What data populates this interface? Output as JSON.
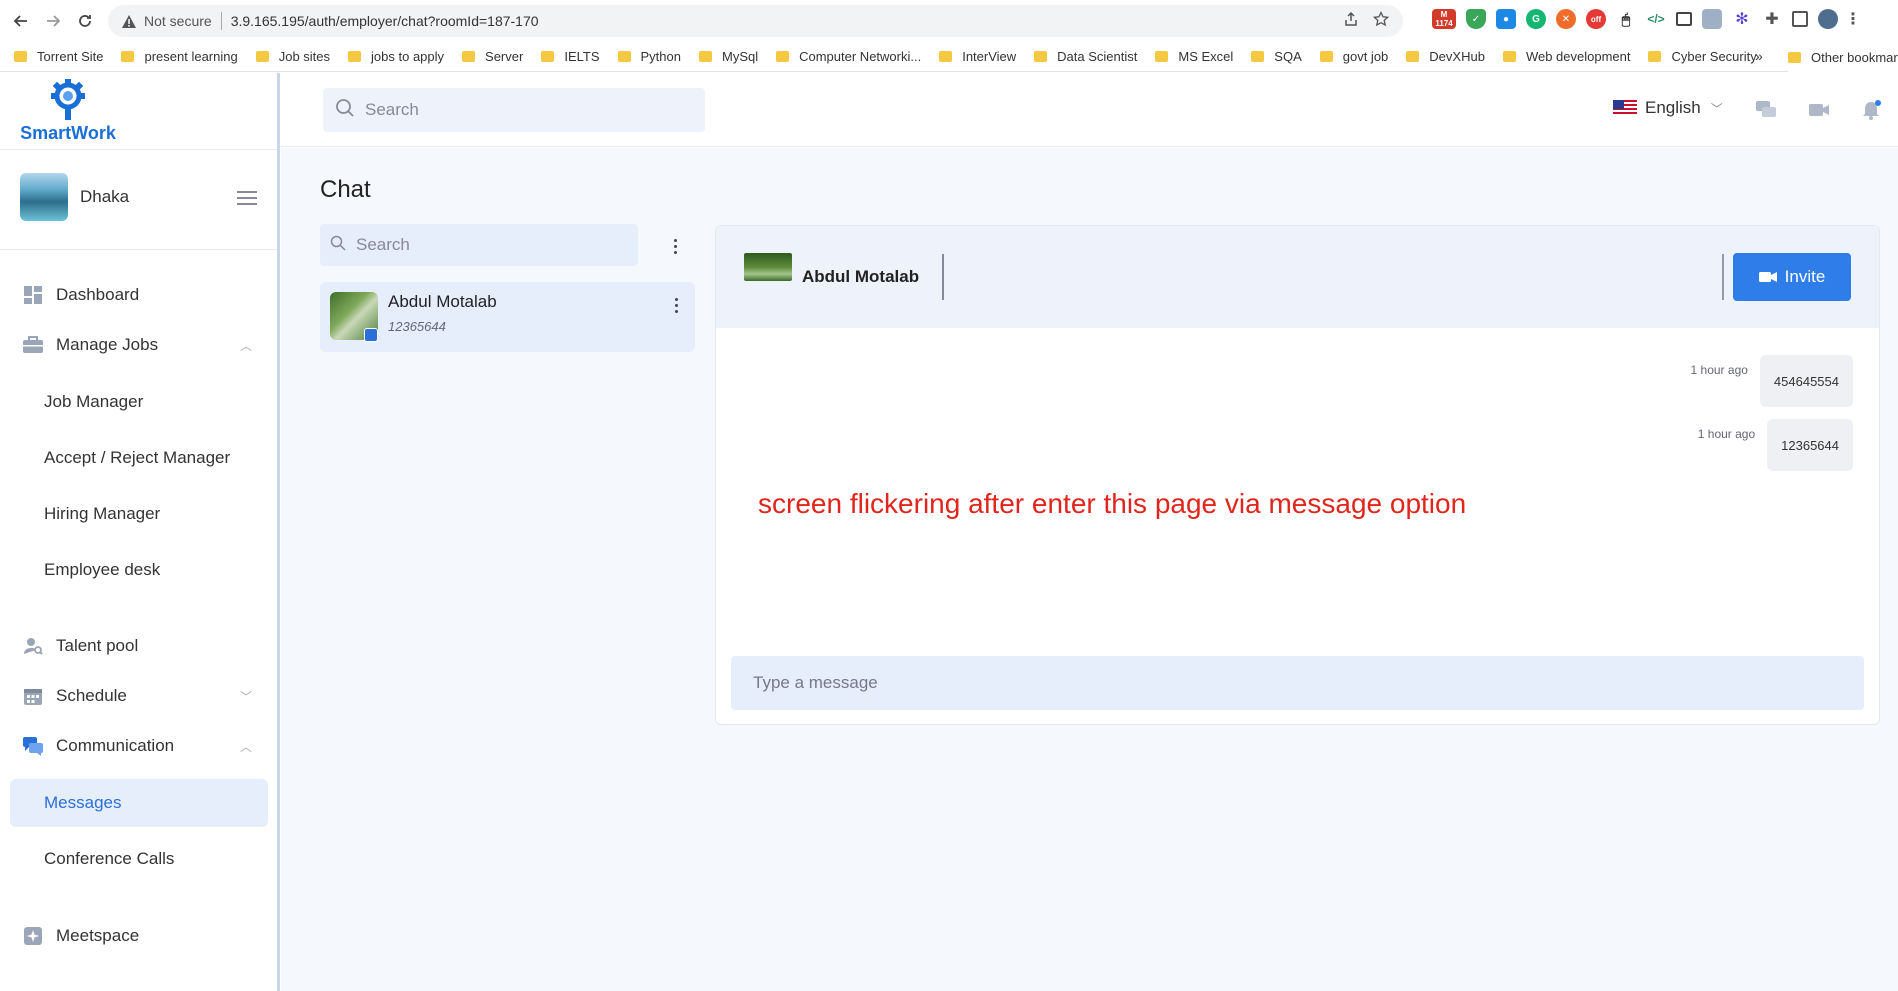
{
  "browser": {
    "security_label": "Not secure",
    "url": "3.9.165.195/auth/employer/chat?roomId=187-170",
    "extension_badge": "1174",
    "bookmarks": [
      "Torrent Site",
      "present learning",
      "Job sites",
      "jobs to apply",
      "Server",
      "IELTS",
      "Python",
      "MySql",
      "Computer Networki...",
      "InterView",
      "Data Scientist",
      "MS Excel",
      "SQA",
      "govt job",
      "DevXHub",
      "Web development",
      "Cyber Security"
    ],
    "bookmarks_overflow": "»",
    "other_bookmarks": "Other bookmarks"
  },
  "app": {
    "brand": "SmartWork",
    "brand_color": "#1a6fd6",
    "accent_color": "#2f7de8"
  },
  "sidebar": {
    "profile_name": "Dhaka",
    "items": {
      "dashboard": "Dashboard",
      "manage_jobs": "Manage Jobs",
      "job_manager": "Job Manager",
      "accept_reject_manager": "Accept / Reject Manager",
      "hiring_manager": "Hiring Manager",
      "employee_desk": "Employee desk",
      "talent_pool": "Talent pool",
      "schedule": "Schedule",
      "communication": "Communication",
      "messages": "Messages",
      "conference_calls": "Conference Calls",
      "meetspace": "Meetspace"
    },
    "active_item": "messages"
  },
  "header": {
    "search_placeholder": "Search",
    "language": "English"
  },
  "chat": {
    "title": "Chat",
    "search_placeholder": "Search",
    "rooms": [
      {
        "name": "Abdul Motalab",
        "last_message": "12365644"
      }
    ],
    "active_contact": "Abdul Motalab",
    "invite_label": "Invite",
    "messages": [
      {
        "time": "1 hour ago",
        "text": "454645554"
      },
      {
        "time": "1 hour ago",
        "text": "12365644"
      }
    ],
    "input_placeholder": "Type a message"
  },
  "annotation": "screen flickering after enter this page via message option"
}
